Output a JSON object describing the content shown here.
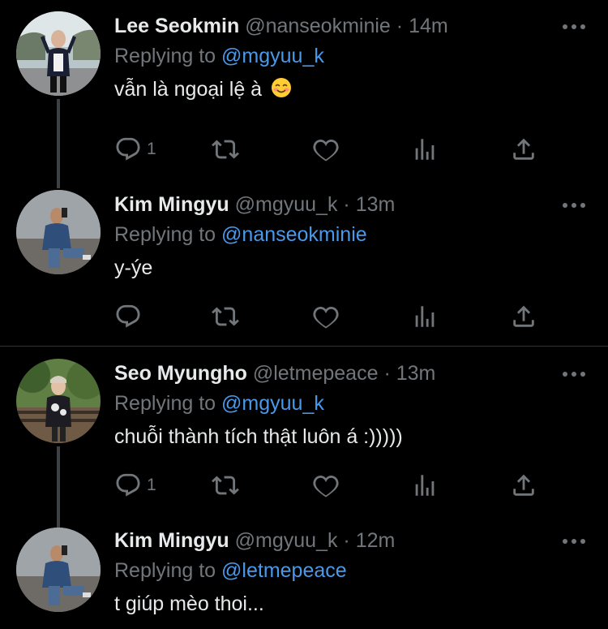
{
  "tweets": [
    {
      "name": "Lee Seokmin",
      "handle": "@nanseokminie",
      "separator": "·",
      "time": "14m",
      "replying_prefix": "Replying to",
      "replying_to": "@mgyuu_k",
      "text": "vẫn là ngoại lệ à",
      "emoji": "smiling-face-with-blush",
      "reply_count": "1",
      "retweet_count": "",
      "like_count": ""
    },
    {
      "name": "Kim Mingyu",
      "handle": "@mgyuu_k",
      "separator": "·",
      "time": "13m",
      "replying_prefix": "Replying to",
      "replying_to": "@nanseokminie",
      "text": "y-ýe",
      "reply_count": "",
      "retweet_count": "",
      "like_count": ""
    },
    {
      "name": "Seo Myungho",
      "handle": "@letmepeace",
      "separator": "·",
      "time": "13m",
      "replying_prefix": "Replying to",
      "replying_to": "@mgyuu_k",
      "text": "chuỗi thành tích thật luôn á :)))))",
      "reply_count": "1",
      "retweet_count": "",
      "like_count": ""
    },
    {
      "name": "Kim Mingyu",
      "handle": "@mgyuu_k",
      "separator": "·",
      "time": "12m",
      "replying_prefix": "Replying to",
      "replying_to": "@letmepeace",
      "text": "t giúp mèo thoi..."
    }
  ],
  "icons": {
    "reply": "reply-icon",
    "retweet": "retweet-icon",
    "like": "like-icon",
    "analytics": "analytics-icon",
    "share": "share-icon",
    "more": "more-icon"
  },
  "colors": {
    "background": "#000000",
    "text": "#e7e9ea",
    "secondary": "#71767b",
    "link": "#4a99e9",
    "thread_line": "#3e4144",
    "divider": "#2f3336"
  }
}
